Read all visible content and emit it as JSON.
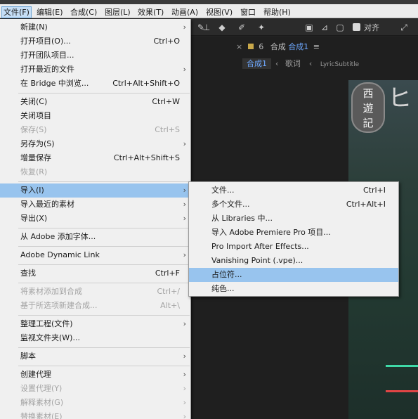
{
  "menubar": {
    "items": [
      "文件(F)",
      "编辑(E)",
      "合成(C)",
      "图层(L)",
      "效果(T)",
      "动画(A)",
      "视图(V)",
      "窗口",
      "帮助(H)"
    ]
  },
  "toolbar": {
    "snap_label": "对齐"
  },
  "panel": {
    "tab_close": "×",
    "tab_lock": "6",
    "tab_prefix": "合成",
    "tab_name": "合成1",
    "tab_menu": "≡",
    "crumb_active": "合成1",
    "crumb_2": "歌词",
    "crumb_3": "LyricSubtitle"
  },
  "logo": {
    "badge": "西\n遊\n記",
    "glyph": "ヒ"
  },
  "file_menu": {
    "items": [
      {
        "label": "新建(N)",
        "shortcut": "",
        "arrow": "›",
        "state": "normal"
      },
      {
        "label": "打开项目(O)...",
        "shortcut": "Ctrl+O",
        "arrow": "",
        "state": "normal"
      },
      {
        "label": "打开团队项目...",
        "shortcut": "",
        "arrow": "",
        "state": "normal"
      },
      {
        "label": "打开最近的文件",
        "shortcut": "",
        "arrow": "›",
        "state": "normal"
      },
      {
        "label": "在 Bridge 中浏览...",
        "shortcut": "Ctrl+Alt+Shift+O",
        "arrow": "",
        "state": "normal"
      },
      {
        "label": "关闭(C)",
        "shortcut": "Ctrl+W",
        "arrow": "",
        "state": "normal"
      },
      {
        "label": "关闭项目",
        "shortcut": "",
        "arrow": "",
        "state": "normal"
      },
      {
        "label": "保存(S)",
        "shortcut": "Ctrl+S",
        "arrow": "",
        "state": "disabled"
      },
      {
        "label": "另存为(S)",
        "shortcut": "",
        "arrow": "›",
        "state": "normal"
      },
      {
        "label": "增量保存",
        "shortcut": "Ctrl+Alt+Shift+S",
        "arrow": "",
        "state": "normal"
      },
      {
        "label": "恢复(R)",
        "shortcut": "",
        "arrow": "",
        "state": "disabled"
      },
      {
        "label": "导入(I)",
        "shortcut": "",
        "arrow": "›",
        "state": "highlighted"
      },
      {
        "label": "导入最近的素材",
        "shortcut": "",
        "arrow": "›",
        "state": "normal"
      },
      {
        "label": "导出(X)",
        "shortcut": "",
        "arrow": "›",
        "state": "normal"
      },
      {
        "label": "从 Adobe 添加字体...",
        "shortcut": "",
        "arrow": "",
        "state": "normal"
      },
      {
        "label": "Adobe Dynamic Link",
        "shortcut": "",
        "arrow": "›",
        "state": "normal"
      },
      {
        "label": "查找",
        "shortcut": "Ctrl+F",
        "arrow": "",
        "state": "normal"
      },
      {
        "label": "将素材添加到合成",
        "shortcut": "Ctrl+/",
        "arrow": "",
        "state": "disabled"
      },
      {
        "label": "基于所选项新建合成...",
        "shortcut": "Alt+\\",
        "arrow": "",
        "state": "disabled"
      },
      {
        "label": "整理工程(文件)",
        "shortcut": "",
        "arrow": "›",
        "state": "normal"
      },
      {
        "label": "监视文件夹(W)...",
        "shortcut": "",
        "arrow": "",
        "state": "normal"
      },
      {
        "label": "脚本",
        "shortcut": "",
        "arrow": "›",
        "state": "normal"
      },
      {
        "label": "创建代理",
        "shortcut": "",
        "arrow": "›",
        "state": "normal"
      },
      {
        "label": "设置代理(Y)",
        "shortcut": "",
        "arrow": "›",
        "state": "disabled"
      },
      {
        "label": "解释素材(G)",
        "shortcut": "",
        "arrow": "›",
        "state": "disabled"
      },
      {
        "label": "替换素材(E)",
        "shortcut": "",
        "arrow": "›",
        "state": "disabled"
      }
    ]
  },
  "import_submenu": {
    "items": [
      {
        "label": "文件...",
        "shortcut": "Ctrl+I",
        "state": "normal"
      },
      {
        "label": "多个文件...",
        "shortcut": "Ctrl+Alt+I",
        "state": "normal"
      },
      {
        "label": "从 Libraries 中...",
        "shortcut": "",
        "state": "normal"
      },
      {
        "label": "导入 Adobe Premiere Pro 项目...",
        "shortcut": "",
        "state": "normal"
      },
      {
        "label": "Pro Import After Effects...",
        "shortcut": "",
        "state": "normal"
      },
      {
        "label": "Vanishing Point (.vpe)...",
        "shortcut": "",
        "state": "normal"
      },
      {
        "label": "占位符...",
        "shortcut": "",
        "state": "highlighted"
      },
      {
        "label": "纯色...",
        "shortcut": "",
        "state": "normal"
      }
    ]
  }
}
